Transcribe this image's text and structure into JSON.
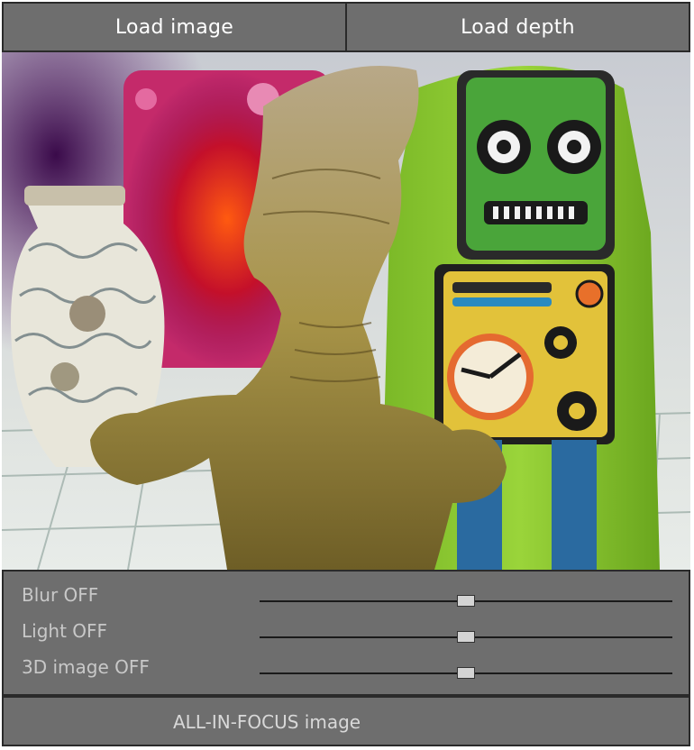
{
  "toolbar": {
    "load_image_label": "Load image",
    "load_depth_label": "Load depth"
  },
  "photo": {
    "alt": ""
  },
  "controls": [
    {
      "label": "Blur OFF",
      "value": 0.5
    },
    {
      "label": "Light OFF",
      "value": 0.5
    },
    {
      "label": "3D image OFF",
      "value": 0.5
    }
  ],
  "footer": {
    "mode_label": "ALL-IN-FOCUS image"
  },
  "colors": {
    "panel": "#6e6e6e",
    "border": "#2a2a2a",
    "text": "#c8c8c8"
  }
}
